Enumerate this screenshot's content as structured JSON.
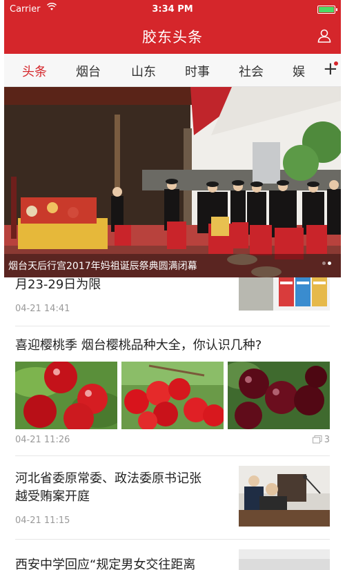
{
  "status_bar": {
    "carrier": "Carrier",
    "time": "3:34 PM",
    "battery_level": 1.0
  },
  "header": {
    "title": "胶东头条"
  },
  "tabs": [
    {
      "label": "头条",
      "active": true
    },
    {
      "label": "烟台",
      "active": false
    },
    {
      "label": "山东",
      "active": false
    },
    {
      "label": "时事",
      "active": false
    },
    {
      "label": "社会",
      "active": false
    },
    {
      "label": "娱",
      "active": false
    }
  ],
  "hero": {
    "caption": "烟台天后行宫2017年妈祖诞辰祭典圆满闭幕",
    "pages": 2,
    "current_page": 2
  },
  "articles": [
    {
      "headline": "月23-29日为限",
      "time": "04-21 14:41"
    },
    {
      "headline": "喜迎樱桃季 烟台樱桃品种大全，你认识几种?",
      "time": "04-21 11:26",
      "comments": "3"
    },
    {
      "headline_line1": "河北省委原常委、政法委原书记张",
      "headline_line2": "越受贿案开庭",
      "time": "04-21 11:15"
    },
    {
      "headline": "西安中学回应“规定男女交往距离"
    }
  ],
  "colors": {
    "brand": "#d5262b",
    "meta_text": "#999999",
    "active_tab": "#d5262b"
  },
  "icons": {
    "user": "user-icon",
    "add_channel": "plus-icon",
    "comment": "comment-icon",
    "wifi": "wifi-icon"
  }
}
